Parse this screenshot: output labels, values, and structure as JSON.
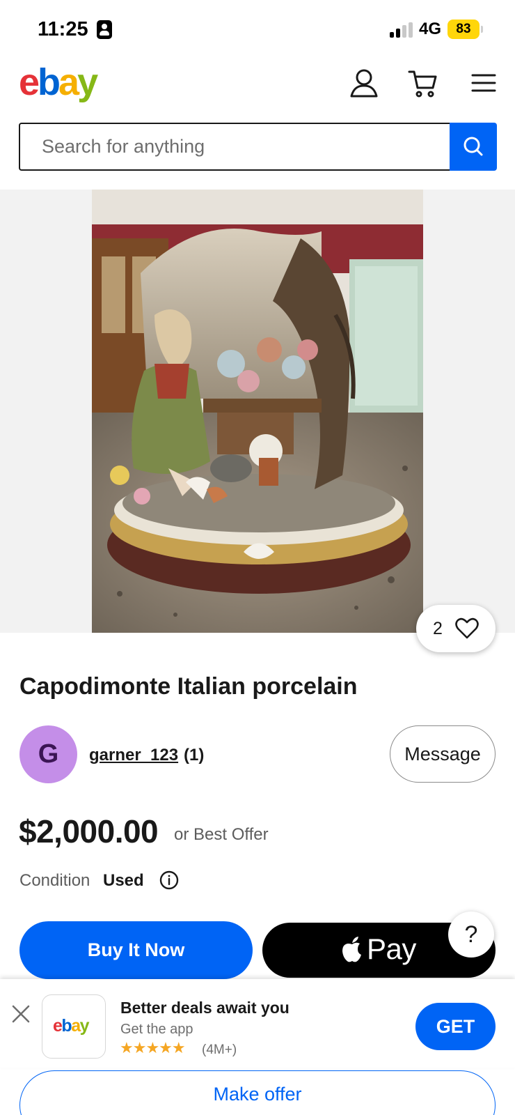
{
  "status_bar": {
    "time": "11:25",
    "network": "4G",
    "battery": "83"
  },
  "header": {
    "logo": [
      "e",
      "b",
      "a",
      "y"
    ],
    "icons": [
      "account-icon",
      "cart-icon",
      "menu-icon"
    ]
  },
  "search": {
    "placeholder": "Search for anything",
    "button_icon": "search-icon"
  },
  "listing": {
    "image_alt": "Capodimonte porcelain figurine of a flower seller under a tree",
    "watch_count": "2",
    "title": "Capodimonte Italian porcelain",
    "seller": {
      "initial": "G",
      "username": "garner_123",
      "feedback": "(1)",
      "message_label": "Message"
    },
    "price": "$2,000.00",
    "price_suffix": "or Best Offer",
    "condition_label": "Condition",
    "condition_value": "Used",
    "buy_now_label": "Buy It Now",
    "apple_pay_label": "Pay",
    "help_label": "?",
    "make_offer_label": "Make offer"
  },
  "app_banner": {
    "icon_logo": [
      "e",
      "b",
      "a",
      "y"
    ],
    "title": "Better deals await you",
    "subtitle": "Get the app",
    "stars": "★★★★★",
    "rating_count": "(4M+)",
    "get_label": "GET"
  },
  "colors": {
    "brand_blue": "#0064f5",
    "logo_red": "#e53238",
    "logo_blue": "#0064d2",
    "logo_yellow": "#f5af02",
    "logo_green": "#86b817",
    "avatar": "#c48ee8",
    "battery": "#ffd60a",
    "stars": "#f5a623"
  }
}
